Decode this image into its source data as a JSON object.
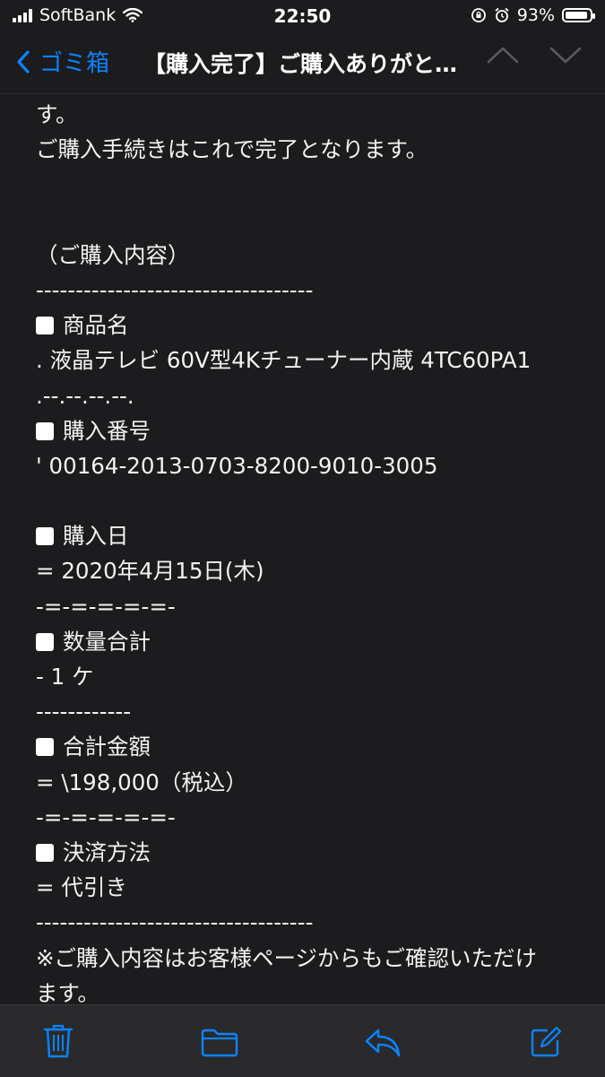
{
  "status_bar": {
    "carrier": "SoftBank",
    "time": "22:50",
    "battery_percent": "93%",
    "battery_level": 0.93
  },
  "nav": {
    "back_label": "ゴミ箱",
    "title": "【購入完了】ご購入ありがと…"
  },
  "body_lines": [
    "す。",
    "ご購入手続きはこれで完了となります。",
    "",
    "",
    "（ご購入内容）",
    "-----------------------------------",
    "商品名",
    ". 液晶テレビ 60V型4Kチューナー内蔵 4TC60PA1",
    ".--.--.--.--.",
    "購入番号",
    "' 00164-2013-0703-8200-9010-3005",
    "",
    "購入日",
    "= 2020年4月15日(木)",
    "-=-=-=-=-=-",
    "数量合計",
    "- 1 ケ",
    "------------",
    "合計金額",
    "= \\198,000（税込）",
    "-=-=-=-=-=-",
    "決済方法",
    "= 代引き",
    "-----------------------------------",
    "※ご購入内容はお客様ページからもご確認いただけ",
    "ます。"
  ],
  "icons": {
    "toolbar": [
      "trash-icon",
      "folder-icon",
      "reply-icon",
      "compose-icon"
    ]
  },
  "colors": {
    "accent": "#0a84ff",
    "background": "#1c1c1e"
  }
}
